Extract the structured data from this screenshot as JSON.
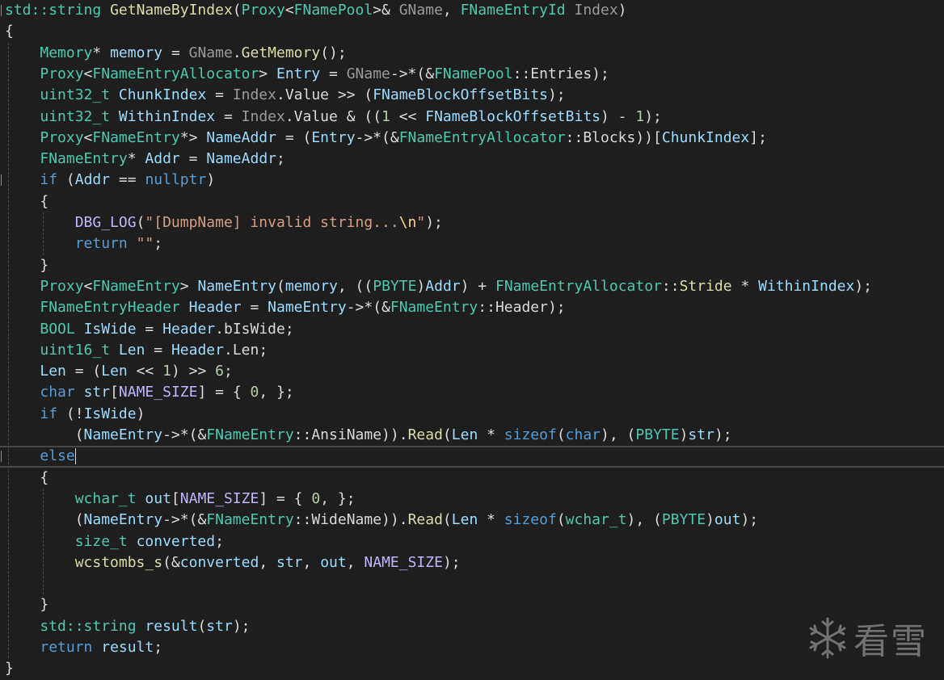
{
  "colors": {
    "background": "#1e1e1e",
    "plain": "#dcdcdc",
    "type": "#4ec9b0",
    "keyword": "#569cd6",
    "function": "#dcdcaa",
    "variable": "#9cdcfe",
    "param": "#9a9a9a",
    "member": "#dadada",
    "string": "#d69d85",
    "number": "#b5cea8",
    "escape": "#ffd68f",
    "macro": "#beb7ff"
  },
  "watermark": {
    "icon": "snowflake-icon",
    "text": "看雪"
  },
  "code": {
    "lines": [
      {
        "indent": 0,
        "tokens": [
          [
            "std::",
            "type"
          ],
          [
            "string",
            "type"
          ],
          [
            " ",
            "plain"
          ],
          [
            "GetNameByIndex",
            "function"
          ],
          [
            "(",
            "plain"
          ],
          [
            "Proxy",
            "type"
          ],
          [
            "<",
            "plain"
          ],
          [
            "FNamePool",
            "type"
          ],
          [
            ">& ",
            "plain"
          ],
          [
            "GName",
            "param"
          ],
          [
            ", ",
            "plain"
          ],
          [
            "FNameEntryId",
            "type"
          ],
          [
            " ",
            "plain"
          ],
          [
            "Index",
            "param"
          ],
          [
            ")",
            "plain"
          ]
        ]
      },
      {
        "indent": 0,
        "tokens": [
          [
            "{",
            "plain"
          ]
        ]
      },
      {
        "indent": 1,
        "tokens": [
          [
            "Memory",
            "type"
          ],
          [
            "* ",
            "plain"
          ],
          [
            "memory",
            "variable"
          ],
          [
            " = ",
            "plain"
          ],
          [
            "GName",
            "param"
          ],
          [
            ".",
            "plain"
          ],
          [
            "GetMemory",
            "function"
          ],
          [
            "();",
            "plain"
          ]
        ]
      },
      {
        "indent": 1,
        "tokens": [
          [
            "Proxy",
            "type"
          ],
          [
            "<",
            "plain"
          ],
          [
            "FNameEntryAllocator",
            "type"
          ],
          [
            "> ",
            "plain"
          ],
          [
            "Entry",
            "variable"
          ],
          [
            " = ",
            "plain"
          ],
          [
            "GName",
            "param"
          ],
          [
            "->*(&",
            "plain"
          ],
          [
            "FNamePool",
            "type"
          ],
          [
            "::",
            "plain"
          ],
          [
            "Entries",
            "member"
          ],
          [
            ");",
            "plain"
          ]
        ]
      },
      {
        "indent": 1,
        "tokens": [
          [
            "uint32_t",
            "type"
          ],
          [
            " ",
            "plain"
          ],
          [
            "ChunkIndex",
            "variable"
          ],
          [
            " = ",
            "plain"
          ],
          [
            "Index",
            "param"
          ],
          [
            ".",
            "plain"
          ],
          [
            "Value",
            "member"
          ],
          [
            " >> (",
            "plain"
          ],
          [
            "FNameBlockOffsetBits",
            "variable"
          ],
          [
            ");",
            "plain"
          ]
        ]
      },
      {
        "indent": 1,
        "tokens": [
          [
            "uint32_t",
            "type"
          ],
          [
            " ",
            "plain"
          ],
          [
            "WithinIndex",
            "variable"
          ],
          [
            " = ",
            "plain"
          ],
          [
            "Index",
            "param"
          ],
          [
            ".",
            "plain"
          ],
          [
            "Value",
            "member"
          ],
          [
            " & ((",
            "plain"
          ],
          [
            "1",
            "number"
          ],
          [
            " << ",
            "plain"
          ],
          [
            "FNameBlockOffsetBits",
            "variable"
          ],
          [
            ") - ",
            "plain"
          ],
          [
            "1",
            "number"
          ],
          [
            ");",
            "plain"
          ]
        ]
      },
      {
        "indent": 1,
        "tokens": [
          [
            "Proxy",
            "type"
          ],
          [
            "<",
            "plain"
          ],
          [
            "FNameEntry",
            "type"
          ],
          [
            "*> ",
            "plain"
          ],
          [
            "NameAddr",
            "variable"
          ],
          [
            " = (",
            "plain"
          ],
          [
            "Entry",
            "variable"
          ],
          [
            "->*(&",
            "plain"
          ],
          [
            "FNameEntryAllocator",
            "type"
          ],
          [
            "::",
            "plain"
          ],
          [
            "Blocks",
            "member"
          ],
          [
            "))[",
            "plain"
          ],
          [
            "ChunkIndex",
            "variable"
          ],
          [
            "];",
            "plain"
          ]
        ]
      },
      {
        "indent": 1,
        "tokens": [
          [
            "FNameEntry",
            "type"
          ],
          [
            "* ",
            "plain"
          ],
          [
            "Addr",
            "variable"
          ],
          [
            " = ",
            "plain"
          ],
          [
            "NameAddr",
            "variable"
          ],
          [
            ";",
            "plain"
          ]
        ]
      },
      {
        "indent": 1,
        "tokens": [
          [
            "if",
            "keyword"
          ],
          [
            " (",
            "plain"
          ],
          [
            "Addr",
            "variable"
          ],
          [
            " == ",
            "plain"
          ],
          [
            "nullptr",
            "keyword"
          ],
          [
            ")",
            "plain"
          ]
        ]
      },
      {
        "indent": 1,
        "tokens": [
          [
            "{",
            "plain"
          ]
        ]
      },
      {
        "indent": 2,
        "tokens": [
          [
            "DBG_LOG",
            "macro"
          ],
          [
            "(",
            "plain"
          ],
          [
            "\"[DumpName] invalid string...",
            "string"
          ],
          [
            "\\n",
            "escape"
          ],
          [
            "\"",
            "string"
          ],
          [
            ");",
            "plain"
          ]
        ]
      },
      {
        "indent": 2,
        "tokens": [
          [
            "return",
            "keyword"
          ],
          [
            " ",
            "plain"
          ],
          [
            "\"\"",
            "string"
          ],
          [
            ";",
            "plain"
          ]
        ]
      },
      {
        "indent": 1,
        "tokens": [
          [
            "}",
            "plain"
          ]
        ]
      },
      {
        "indent": 1,
        "tokens": [
          [
            "Proxy",
            "type"
          ],
          [
            "<",
            "plain"
          ],
          [
            "FNameEntry",
            "type"
          ],
          [
            "> ",
            "plain"
          ],
          [
            "NameEntry",
            "variable"
          ],
          [
            "(",
            "plain"
          ],
          [
            "memory",
            "variable"
          ],
          [
            ", ((",
            "plain"
          ],
          [
            "PBYTE",
            "type"
          ],
          [
            ")",
            "plain"
          ],
          [
            "Addr",
            "variable"
          ],
          [
            ") + ",
            "plain"
          ],
          [
            "FNameEntryAllocator",
            "type"
          ],
          [
            "::",
            "plain"
          ],
          [
            "Stride",
            "function"
          ],
          [
            " * ",
            "plain"
          ],
          [
            "WithinIndex",
            "variable"
          ],
          [
            ");",
            "plain"
          ]
        ]
      },
      {
        "indent": 1,
        "tokens": [
          [
            "FNameEntryHeader",
            "type"
          ],
          [
            " ",
            "plain"
          ],
          [
            "Header",
            "variable"
          ],
          [
            " = ",
            "plain"
          ],
          [
            "NameEntry",
            "variable"
          ],
          [
            "->*(&",
            "plain"
          ],
          [
            "FNameEntry",
            "type"
          ],
          [
            "::",
            "plain"
          ],
          [
            "Header",
            "member"
          ],
          [
            ");",
            "plain"
          ]
        ]
      },
      {
        "indent": 1,
        "tokens": [
          [
            "BOOL",
            "type"
          ],
          [
            " ",
            "plain"
          ],
          [
            "IsWide",
            "variable"
          ],
          [
            " = ",
            "plain"
          ],
          [
            "Header",
            "variable"
          ],
          [
            ".",
            "plain"
          ],
          [
            "bIsWide",
            "member"
          ],
          [
            ";",
            "plain"
          ]
        ]
      },
      {
        "indent": 1,
        "tokens": [
          [
            "uint16_t",
            "type"
          ],
          [
            " ",
            "plain"
          ],
          [
            "Len",
            "variable"
          ],
          [
            " = ",
            "plain"
          ],
          [
            "Header",
            "variable"
          ],
          [
            ".",
            "plain"
          ],
          [
            "Len",
            "member"
          ],
          [
            ";",
            "plain"
          ]
        ]
      },
      {
        "indent": 1,
        "tokens": [
          [
            "Len",
            "variable"
          ],
          [
            " = (",
            "plain"
          ],
          [
            "Len",
            "variable"
          ],
          [
            " << ",
            "plain"
          ],
          [
            "1",
            "number"
          ],
          [
            ") >> ",
            "plain"
          ],
          [
            "6",
            "number"
          ],
          [
            ";",
            "plain"
          ]
        ]
      },
      {
        "indent": 1,
        "tokens": [
          [
            "char",
            "keyword"
          ],
          [
            " ",
            "plain"
          ],
          [
            "str",
            "variable"
          ],
          [
            "[",
            "plain"
          ],
          [
            "NAME_SIZE",
            "macro"
          ],
          [
            "] = { ",
            "plain"
          ],
          [
            "0",
            "number"
          ],
          [
            ", };",
            "plain"
          ]
        ]
      },
      {
        "indent": 1,
        "tokens": [
          [
            "if",
            "keyword"
          ],
          [
            " (!",
            "plain"
          ],
          [
            "IsWide",
            "variable"
          ],
          [
            ")",
            "plain"
          ]
        ]
      },
      {
        "indent": 2,
        "tokens": [
          [
            "(",
            "plain"
          ],
          [
            "NameEntry",
            "variable"
          ],
          [
            "->*(&",
            "plain"
          ],
          [
            "FNameEntry",
            "type"
          ],
          [
            "::",
            "plain"
          ],
          [
            "AnsiName",
            "member"
          ],
          [
            ")).",
            "plain"
          ],
          [
            "Read",
            "function"
          ],
          [
            "(",
            "plain"
          ],
          [
            "Len",
            "variable"
          ],
          [
            " * ",
            "plain"
          ],
          [
            "sizeof",
            "keyword"
          ],
          [
            "(",
            "plain"
          ],
          [
            "char",
            "keyword"
          ],
          [
            "), (",
            "plain"
          ],
          [
            "PBYTE",
            "type"
          ],
          [
            ")",
            "plain"
          ],
          [
            "str",
            "variable"
          ],
          [
            ");",
            "plain"
          ]
        ]
      },
      {
        "indent": 1,
        "current": true,
        "tokens": [
          [
            "else",
            "keyword"
          ]
        ]
      },
      {
        "indent": 1,
        "tokens": [
          [
            "{",
            "plain"
          ]
        ]
      },
      {
        "indent": 2,
        "tokens": [
          [
            "wchar_t",
            "type"
          ],
          [
            " ",
            "plain"
          ],
          [
            "out",
            "variable"
          ],
          [
            "[",
            "plain"
          ],
          [
            "NAME_SIZE",
            "macro"
          ],
          [
            "] = { ",
            "plain"
          ],
          [
            "0",
            "number"
          ],
          [
            ", };",
            "plain"
          ]
        ]
      },
      {
        "indent": 2,
        "tokens": [
          [
            "(",
            "plain"
          ],
          [
            "NameEntry",
            "variable"
          ],
          [
            "->*(&",
            "plain"
          ],
          [
            "FNameEntry",
            "type"
          ],
          [
            "::",
            "plain"
          ],
          [
            "WideName",
            "member"
          ],
          [
            ")).",
            "plain"
          ],
          [
            "Read",
            "function"
          ],
          [
            "(",
            "plain"
          ],
          [
            "Len",
            "variable"
          ],
          [
            " * ",
            "plain"
          ],
          [
            "sizeof",
            "keyword"
          ],
          [
            "(",
            "plain"
          ],
          [
            "wchar_t",
            "type"
          ],
          [
            "), (",
            "plain"
          ],
          [
            "PBYTE",
            "type"
          ],
          [
            ")",
            "plain"
          ],
          [
            "out",
            "variable"
          ],
          [
            ");",
            "plain"
          ]
        ]
      },
      {
        "indent": 2,
        "tokens": [
          [
            "size_t",
            "type"
          ],
          [
            " ",
            "plain"
          ],
          [
            "converted",
            "variable"
          ],
          [
            ";",
            "plain"
          ]
        ]
      },
      {
        "indent": 2,
        "tokens": [
          [
            "wcstombs_s",
            "function"
          ],
          [
            "(&",
            "plain"
          ],
          [
            "converted",
            "variable"
          ],
          [
            ", ",
            "plain"
          ],
          [
            "str",
            "variable"
          ],
          [
            ", ",
            "plain"
          ],
          [
            "out",
            "variable"
          ],
          [
            ", ",
            "plain"
          ],
          [
            "NAME_SIZE",
            "macro"
          ],
          [
            ");",
            "plain"
          ]
        ]
      },
      {
        "indent": 2,
        "tokens": []
      },
      {
        "indent": 1,
        "tokens": [
          [
            "}",
            "plain"
          ]
        ]
      },
      {
        "indent": 1,
        "tokens": [
          [
            "std::",
            "type"
          ],
          [
            "string",
            "type"
          ],
          [
            " ",
            "plain"
          ],
          [
            "result",
            "variable"
          ],
          [
            "(",
            "plain"
          ],
          [
            "str",
            "variable"
          ],
          [
            ");",
            "plain"
          ]
        ]
      },
      {
        "indent": 1,
        "tokens": [
          [
            "return",
            "keyword"
          ],
          [
            " ",
            "plain"
          ],
          [
            "result",
            "variable"
          ],
          [
            ";",
            "plain"
          ]
        ]
      },
      {
        "indent": 0,
        "tokens": [
          [
            "}",
            "plain"
          ]
        ]
      }
    ]
  }
}
